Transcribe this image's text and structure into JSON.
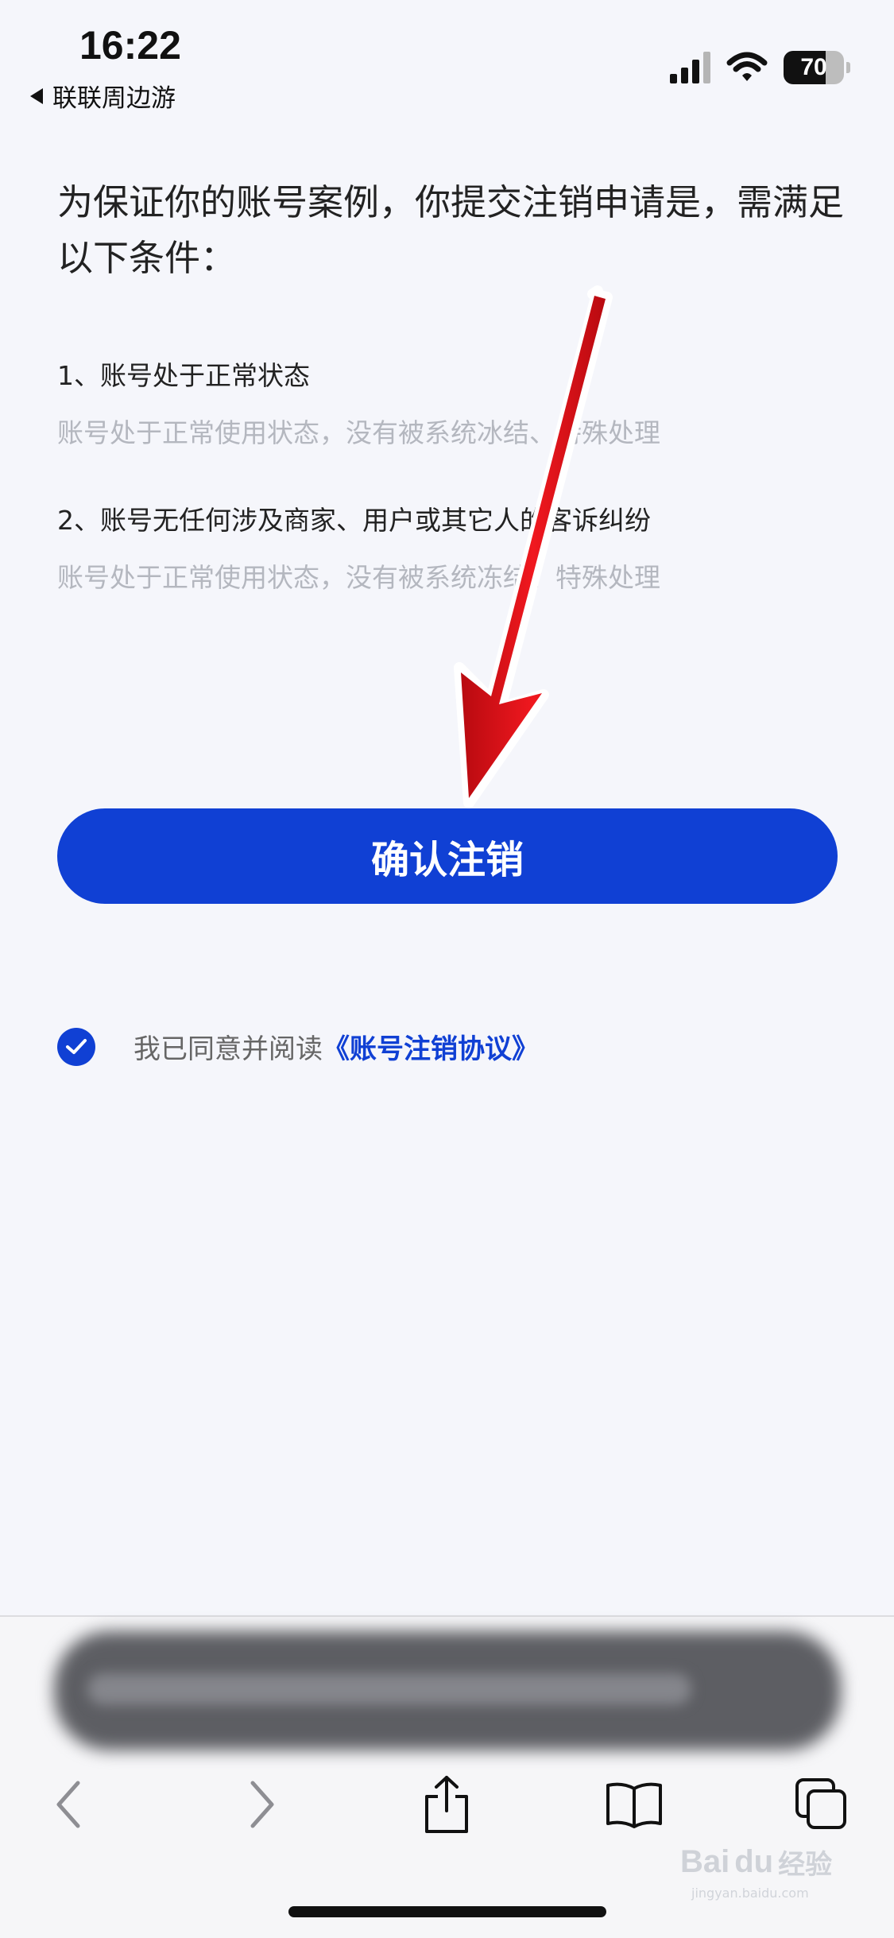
{
  "status_bar": {
    "time": "16:22",
    "back_app": "联联周边游",
    "battery": "70"
  },
  "content": {
    "intro": "为保证你的账号案例，你提交注销申请是，需满足以下条件：",
    "conditions": [
      {
        "title": "1、账号处于正常状态",
        "desc": "账号处于正常使用状态，没有被系统冰结、特殊处理"
      },
      {
        "title": "2、账号无任何涉及商家、用户或其它人的客诉纠纷",
        "desc": "账号处于正常使用状态，没有被系统冻结、特殊处理"
      }
    ],
    "confirm_button": "确认注销",
    "agreement": {
      "text": "我已同意并阅读",
      "link": "《账号注销协议》",
      "checked": true
    }
  },
  "watermark": {
    "brand": "Bai",
    "brand_suffix": "du",
    "cn": "经验",
    "url": "jingyan.baidu.com"
  },
  "colors": {
    "accent": "#1040d4",
    "background": "#f5f6fb",
    "arrow": "#e8141a"
  },
  "icons": [
    "back-triangle-icon",
    "signal-icon",
    "wifi-icon",
    "battery-icon",
    "checkmark-icon",
    "chevron-left-icon",
    "chevron-right-icon",
    "share-icon",
    "bookmarks-icon",
    "tabs-icon",
    "annotation-arrow-icon"
  ]
}
